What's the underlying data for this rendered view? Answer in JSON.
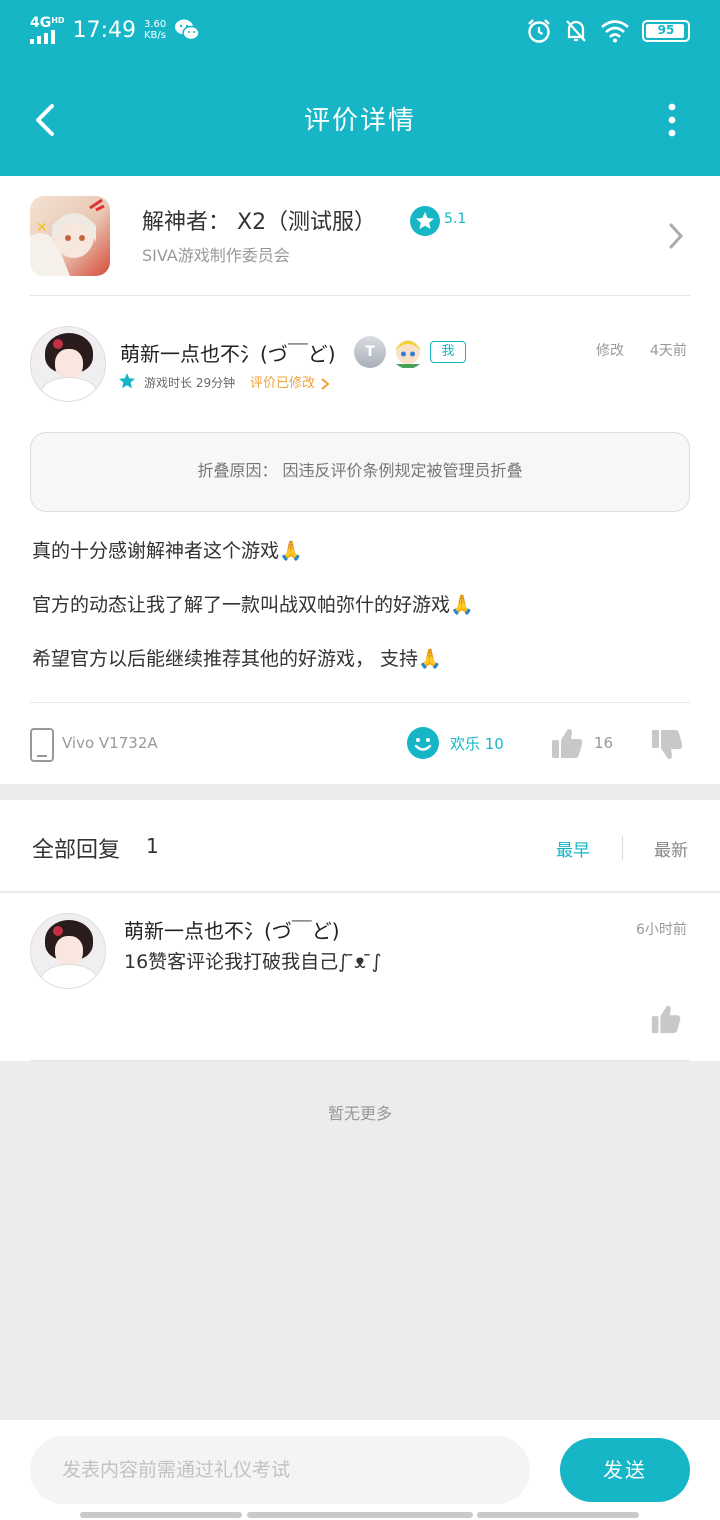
{
  "status_bar": {
    "network": "4G",
    "hd": "HD",
    "time": "17:49",
    "speed_value": "3.60",
    "speed_unit": "KB/s",
    "battery": "95",
    "battery_level": 0.95
  },
  "navbar": {
    "title": "评价详情"
  },
  "game": {
    "name": "解神者： X2（测试服）",
    "rating": "5.1",
    "developer": "SIVA游戏制作委员会"
  },
  "review": {
    "author": "萌新一点也不氵(づ￣ど)",
    "badge_level": "T",
    "badge_me": "我",
    "edited": "修改",
    "time": "4天前",
    "play_time": "游戏时长 29分钟",
    "edited_link": "评价已修改",
    "fold_reason": "折叠原因： 因违反评价条例规定被管理员折叠",
    "lines": [
      "真的十分感谢解神者这个游戏🙏",
      "官方的动态让我了解了一款叫战双帕弥什的好游戏🙏",
      "希望官方以后能继续推荐其他的好游戏， 支持🙏"
    ],
    "device": "Vivo V1732A",
    "happy": "欢乐 10",
    "likes": "16"
  },
  "replies": {
    "title": "全部回复",
    "count": "1",
    "sort_earliest": "最早",
    "sort_latest": "最新",
    "items": [
      {
        "author": "萌新一点也不氵(づ￣ど)",
        "time": "6小时前",
        "text": "16赞客评论我打破我自己∫ ̄ᴥ ̄∫"
      }
    ],
    "no_more": "暂无更多"
  },
  "composer": {
    "placeholder": "发表内容前需通过礼仪考试",
    "send": "发送"
  },
  "colors": {
    "accent": "#16b6c6",
    "orange": "#f0a23a"
  }
}
